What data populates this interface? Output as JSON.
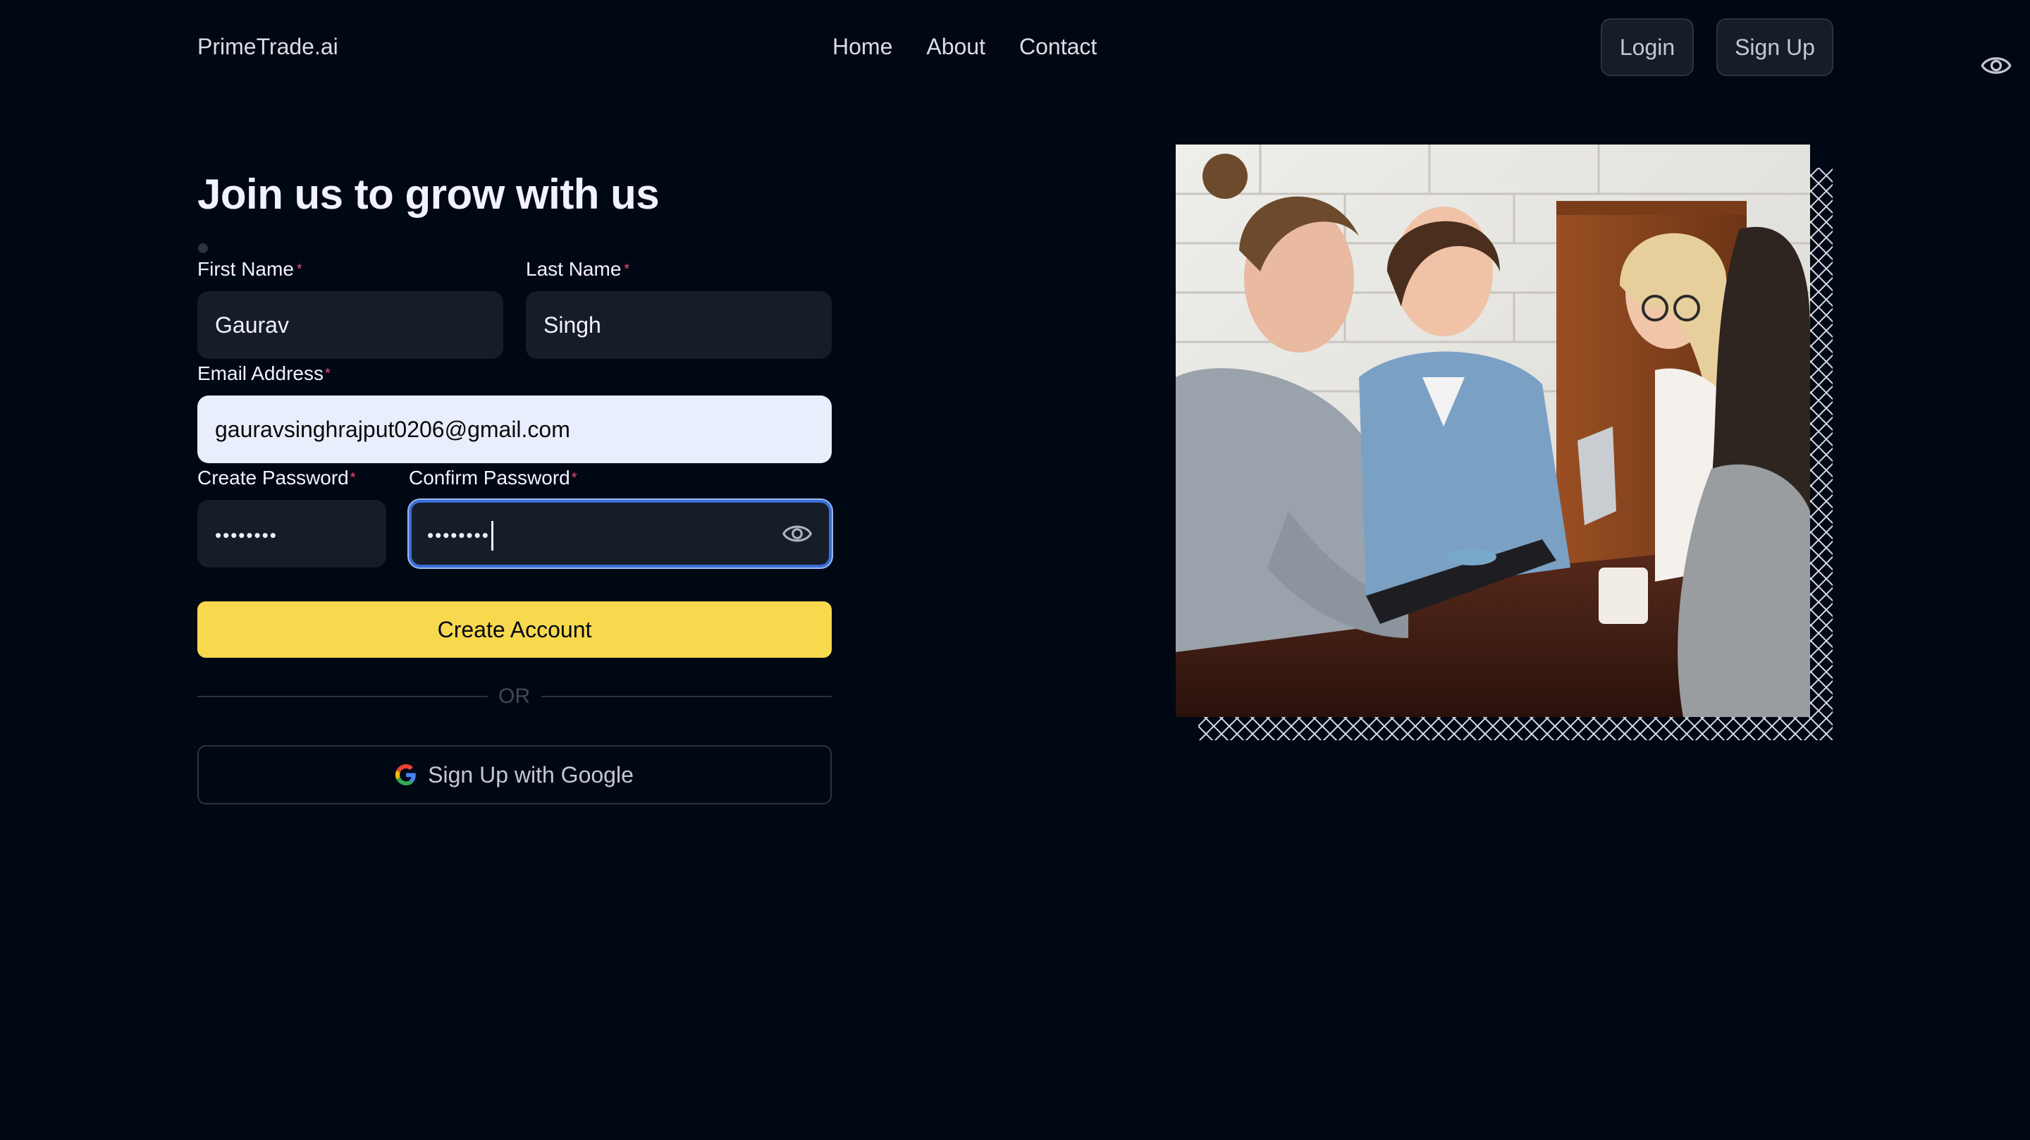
{
  "nav": {
    "logo": "PrimeTrade.ai",
    "links": [
      "Home",
      "About",
      "Contact"
    ],
    "login_label": "Login",
    "signup_label": "Sign Up"
  },
  "form": {
    "heading": "Join us to grow with us",
    "first_name": {
      "label": "First Name",
      "value": "Gaurav"
    },
    "last_name": {
      "label": "Last Name",
      "value": "Singh"
    },
    "email": {
      "label": "Email Address",
      "value": "gauravsinghrajput0206@gmail.com"
    },
    "create_password": {
      "label": "Create Password",
      "value": "••••••••"
    },
    "confirm_password": {
      "label": "Confirm Password",
      "value": "••••••••"
    },
    "required_mark": "*",
    "submit_label": "Create Account",
    "divider_text": "OR",
    "google_label": "Sign Up with Google"
  },
  "colors": {
    "background": "#000814",
    "accent": "#f8d94d",
    "field": "#161d29",
    "required": "#ef476f",
    "focus": "#3b6fd8"
  },
  "icons": {
    "visibility": "eye-icon",
    "google": "google-icon"
  }
}
